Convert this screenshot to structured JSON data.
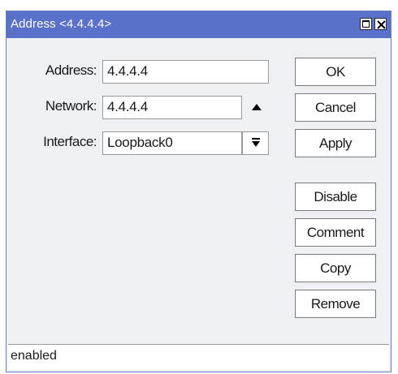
{
  "window": {
    "title": "Address <4.4.4.4>"
  },
  "form": {
    "address": {
      "label": "Address:",
      "value": "4.4.4.4"
    },
    "network": {
      "label": "Network:",
      "value": "4.4.4.4"
    },
    "interface": {
      "label": "Interface:",
      "value": "Loopback0"
    }
  },
  "buttons": {
    "ok": "OK",
    "cancel": "Cancel",
    "apply": "Apply",
    "disable": "Disable",
    "comment": "Comment",
    "copy": "Copy",
    "remove": "Remove"
  },
  "status": {
    "text": "enabled"
  },
  "icons": {
    "maximize": "maximize-icon",
    "close": "close-icon",
    "network_toggle": "triangle-up-icon",
    "interface_dropdown": "dropdown-arrow-icon"
  },
  "colors": {
    "titlebar": "#5a71c9",
    "window_bg": "#eef0f4"
  }
}
